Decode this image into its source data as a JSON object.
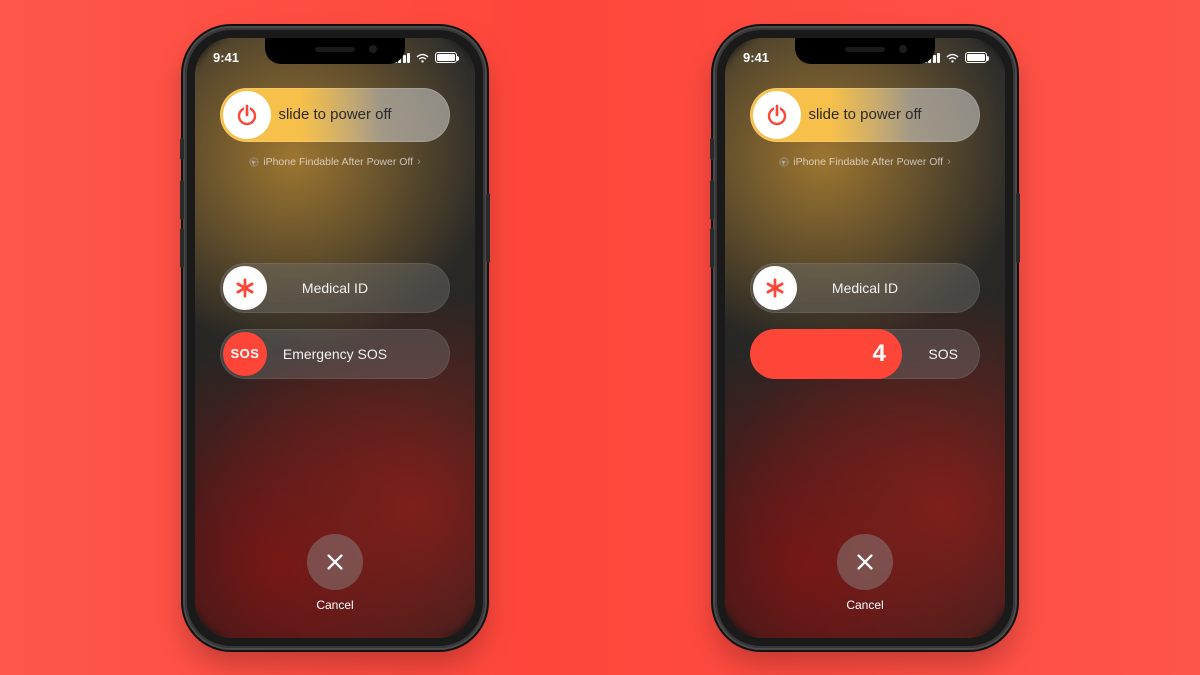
{
  "status": {
    "time": "9:41"
  },
  "power": {
    "slide_label": "slide to power off"
  },
  "findable": {
    "text": "iPhone Findable After Power Off"
  },
  "medical": {
    "label": "Medical ID"
  },
  "sos": {
    "label": "Emergency SOS",
    "knob_text": "SOS",
    "tail_text": "SOS",
    "countdown": "4"
  },
  "cancel": {
    "label": "Cancel"
  },
  "colors": {
    "accent_red": "#fd4538",
    "power_yellow": "#f6c04a"
  }
}
